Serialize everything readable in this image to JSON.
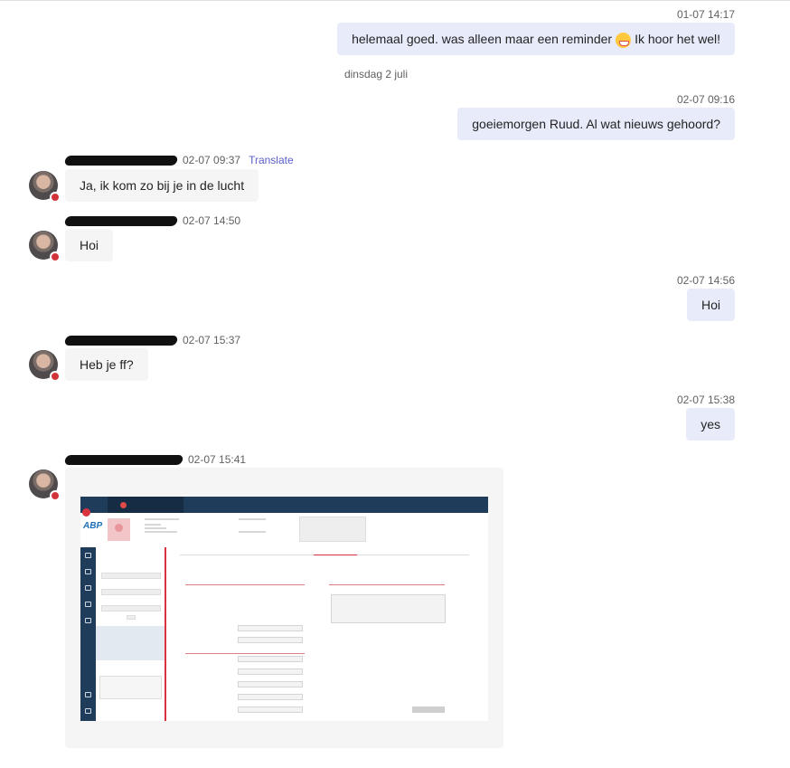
{
  "messages": {
    "m1": {
      "time": "01-07 14:17",
      "text_before": "helemaal goed. was alleen maar een reminder",
      "emoji": "grinning-face-emoji",
      "text_after": " Ik hoor het wel!"
    },
    "date_separator": "dinsdag 2 juli",
    "m2": {
      "time": "02-07 09:16",
      "text": "goeiemorgen Ruud. Al wat nieuws gehoord?"
    },
    "m3": {
      "time": "02-07 09:37",
      "translate": "Translate",
      "text": "Ja, ik kom zo bij je in de lucht"
    },
    "m4": {
      "time": "02-07 14:50",
      "text": "Hoi"
    },
    "m5": {
      "time": "02-07 14:56",
      "text": "Hoi"
    },
    "m6": {
      "time": "02-07 15:37",
      "text": "Heb je ff?"
    },
    "m7": {
      "time": "02-07 15:38",
      "text": "yes"
    },
    "m8": {
      "time": "02-07 15:41"
    }
  },
  "colors": {
    "my_bubble": "#e8ebfa",
    "their_bubble": "#f5f5f5",
    "status_busy": "#d13438",
    "link": "#5b5fc7"
  },
  "icons": [
    "avatar",
    "busy-status-icon",
    "grinning-face-emoji"
  ]
}
